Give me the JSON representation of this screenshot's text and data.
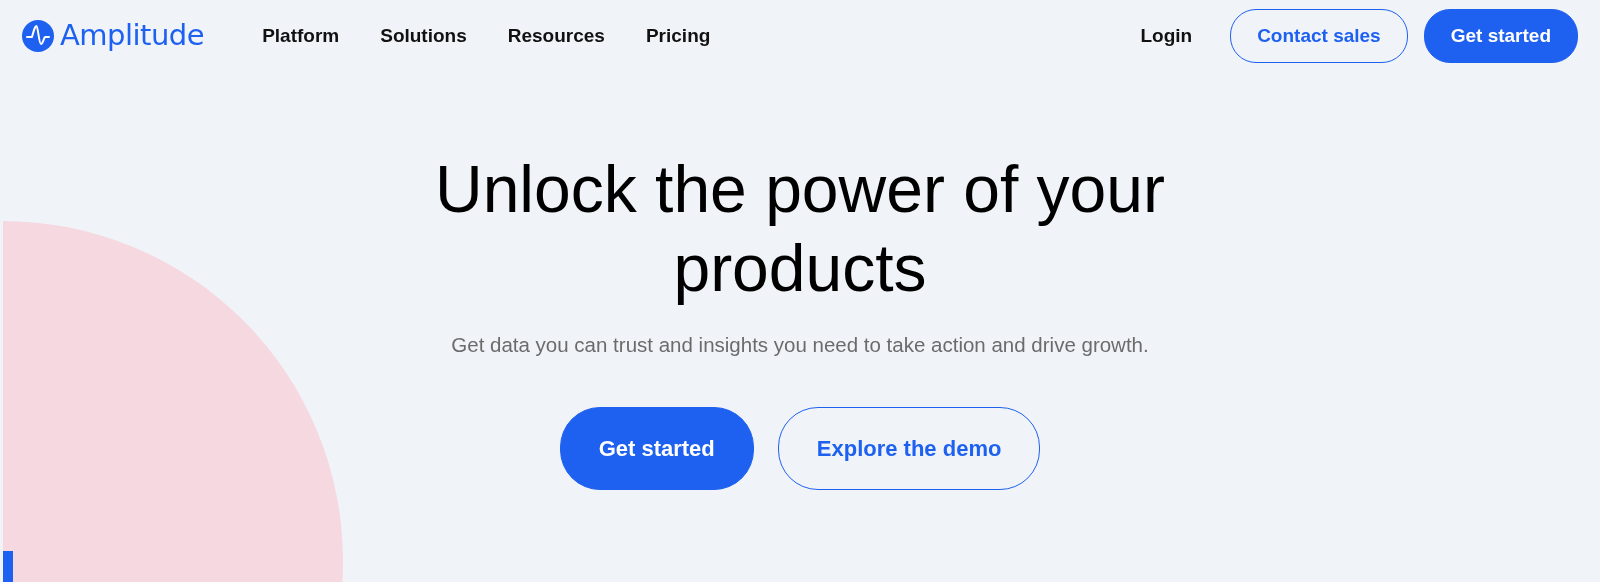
{
  "brand": {
    "name": "Amplitude"
  },
  "nav": {
    "items": [
      "Platform",
      "Solutions",
      "Resources",
      "Pricing"
    ],
    "login": "Login",
    "buttons": [
      {
        "label": "Contact sales",
        "kind": "outline"
      },
      {
        "label": "Get started",
        "kind": "solid"
      }
    ]
  },
  "hero": {
    "title": "Unlock the power of your products",
    "subtitle": "Get data you can trust and insights you need to take action and drive growth.",
    "buttons": [
      {
        "label": "Get started",
        "kind": "solid"
      },
      {
        "label": "Explore the demo",
        "kind": "outline"
      }
    ]
  }
}
